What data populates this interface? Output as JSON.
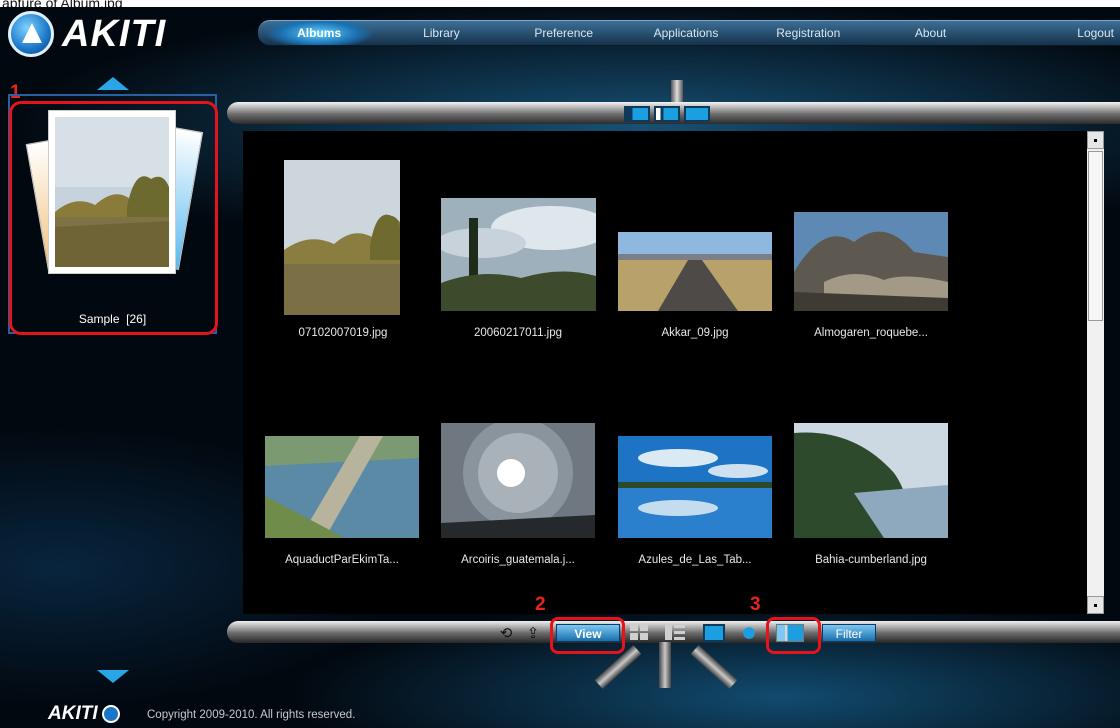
{
  "caption": "apture of Album.jpg",
  "header": {
    "logo_text": "AKITI",
    "nav": [
      "Albums",
      "Library",
      "Preference",
      "Applications",
      "Registration",
      "About",
      "Logout"
    ],
    "active_nav": "Albums"
  },
  "sidebar": {
    "album": {
      "name": "Sample",
      "count": "[26]"
    }
  },
  "markers": [
    "1",
    "2",
    "3"
  ],
  "thumbnails": [
    {
      "label": "07102007019.jpg",
      "icon": "autumn-trees-photo"
    },
    {
      "label": "20060217011.jpg",
      "icon": "cypress-sky-photo"
    },
    {
      "label": "Akkar_09.jpg",
      "icon": "road-photo"
    },
    {
      "label": "Almogaren_roquebe...",
      "icon": "rocky-hill-photo"
    },
    {
      "label": "AquaductParEkimTa...",
      "icon": "aqueduct-aerial-photo"
    },
    {
      "label": "Arcoiris_guatemala.j...",
      "icon": "sun-halo-photo"
    },
    {
      "label": "Azules_de_Las_Tab...",
      "icon": "lake-reflection-photo"
    },
    {
      "label": "Bahia-cumberland.jpg",
      "icon": "bay-cliff-photo"
    }
  ],
  "toolbar": {
    "view_label": "View",
    "filter_label": "Filter"
  },
  "footer": {
    "logo_text": "AKITI",
    "copyright": "Copyright 2009-2010. All rights reserved."
  },
  "colors": {
    "accent": "#1c9fe0",
    "highlight": "#e5131b",
    "background": "#02080f"
  }
}
